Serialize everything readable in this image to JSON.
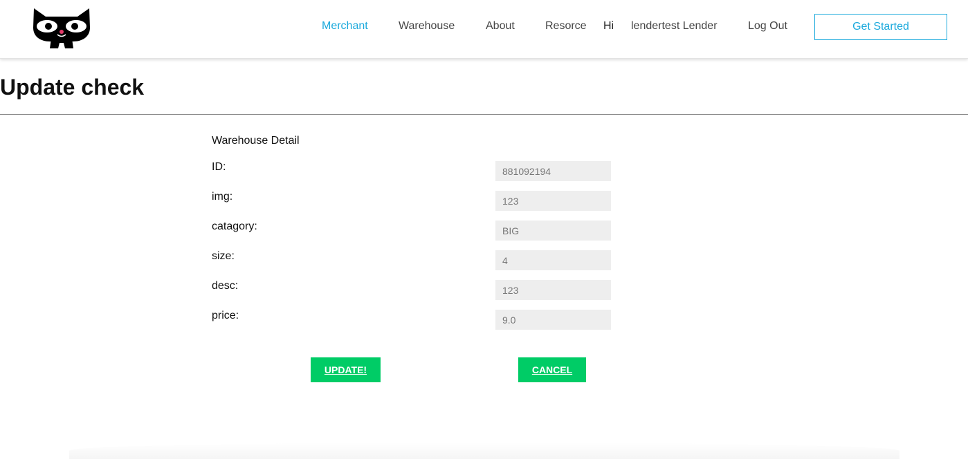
{
  "nav": {
    "items": [
      {
        "label": "Merchant",
        "active": true
      },
      {
        "label": "Warehouse",
        "active": false
      },
      {
        "label": "About",
        "active": false
      },
      {
        "label": "Resorce",
        "active": false
      }
    ],
    "greeting": "Hi",
    "user_name": "lendertest Lender",
    "logout_label": "Log Out",
    "cta_label": "Get Started",
    "logo_icon": "cat-logo-icon",
    "accent_color": "#1aa9dc"
  },
  "page": {
    "title": "Update check",
    "section_title": "Warehouse Detail"
  },
  "form": {
    "fields": [
      {
        "label": "ID:",
        "value": "881092194"
      },
      {
        "label": "img:",
        "value": "123"
      },
      {
        "label": "catagory:",
        "value": "BIG"
      },
      {
        "label": "size:",
        "value": "4"
      },
      {
        "label": "desc:",
        "value": "123"
      },
      {
        "label": "price:",
        "value": "9.0"
      }
    ],
    "update_label": "UPDATE!",
    "cancel_label": "CANCEL",
    "button_color": "#00cc66"
  }
}
